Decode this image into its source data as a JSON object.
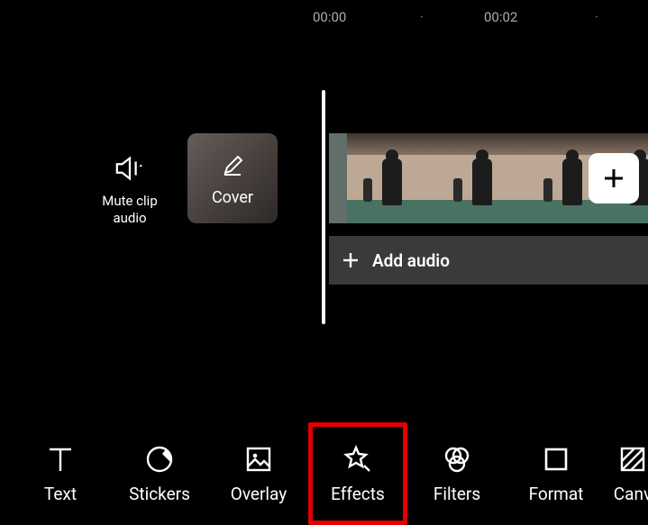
{
  "ruler": {
    "t0": "00:00",
    "t1": "00:02"
  },
  "mute": {
    "label_line1": "Mute clip",
    "label_line2": "audio"
  },
  "cover": {
    "label": "Cover"
  },
  "add_audio": {
    "label": "Add audio"
  },
  "toolbar": {
    "text": {
      "label": "Text"
    },
    "stickers": {
      "label": "Stickers"
    },
    "overlay": {
      "label": "Overlay"
    },
    "effects": {
      "label": "Effects"
    },
    "filters": {
      "label": "Filters"
    },
    "format": {
      "label": "Format"
    },
    "canvas": {
      "label": "Canv"
    }
  }
}
